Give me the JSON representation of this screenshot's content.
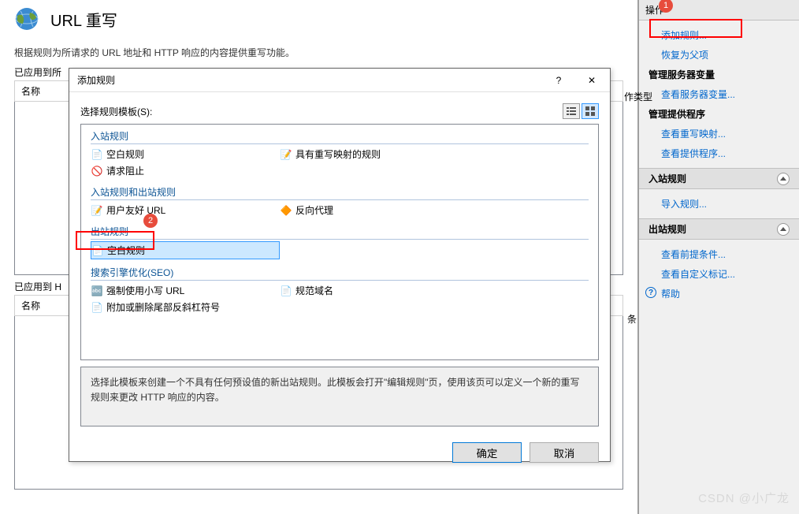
{
  "header": {
    "title": "URL 重写",
    "subtitle": "根据规则为所请求的 URL 地址和 HTTP 响应的内容提供重写功能。"
  },
  "applied1": {
    "label": "已应用到所",
    "col1": "名称",
    "col2": "作类型"
  },
  "applied2": {
    "label": "已应用到 H",
    "col1": "名称",
    "col2": "条"
  },
  "dialog": {
    "title": "添加规则",
    "close_glyph": "✕",
    "help_glyph": "?",
    "select_template": "选择规则模板(S):",
    "groups": {
      "inbound": "入站规则",
      "both": "入站规则和出站规则",
      "outbound": "出站规则",
      "seo": "搜索引擎优化(SEO)"
    },
    "items": {
      "blank_in": "空白规则",
      "with_map": "具有重写映射的规则",
      "block_req": "请求阻止",
      "friendly": "用户友好 URL",
      "reverse": "反向代理",
      "blank_out": "空白规则",
      "lowercase": "强制使用小写 URL",
      "canonical": "规范域名",
      "slash": "附加或删除尾部反斜杠符号"
    },
    "description": "选择此模板来创建一个不具有任何预设值的新出站规则。此模板会打开\"编辑规则\"页，使用该页可以定义一个新的重写规则来更改 HTTP 响应的内容。",
    "ok": "确定",
    "cancel": "取消"
  },
  "actions": {
    "header": "操作",
    "add_rule": "添加规则...",
    "restore_parent": "恢复为父项",
    "manage_vars_title": "管理服务器变量",
    "view_vars": "查看服务器变量...",
    "manage_providers_title": "管理提供程序",
    "view_maps": "查看重写映射...",
    "view_providers": "查看提供程序...",
    "inbound_title": "入站规则",
    "import_rule": "导入规则...",
    "outbound_title": "出站规则",
    "view_precond": "查看前提条件...",
    "view_tags": "查看自定义标记...",
    "help": "帮助"
  },
  "watermark": "CSDN @小广龙"
}
